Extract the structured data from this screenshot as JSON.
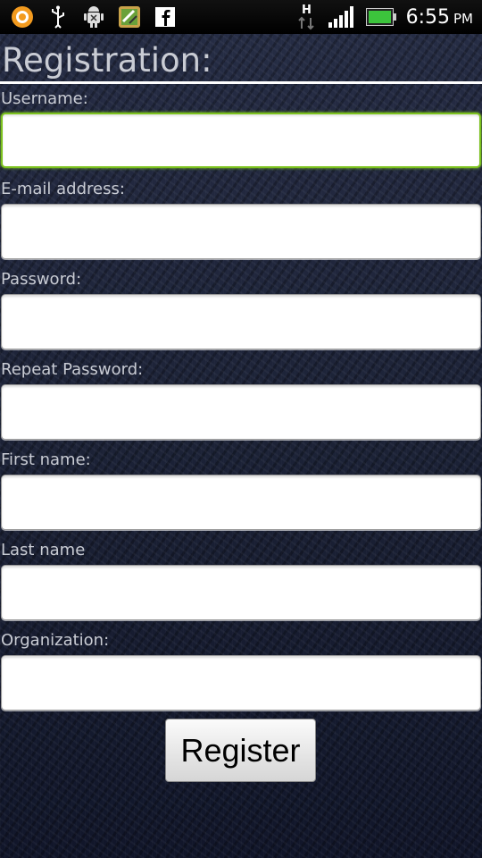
{
  "status_bar": {
    "network_type": "H",
    "time": "6:55",
    "ampm": "PM",
    "notification_icons": [
      "app-circle-icon",
      "usb-icon",
      "android-debug-icon",
      "download-app-icon",
      "facebook-icon"
    ],
    "battery_color": "#3cc43c"
  },
  "page": {
    "title": "Registration:"
  },
  "form": {
    "fields": [
      {
        "label": "Username:",
        "value": "",
        "focused": true
      },
      {
        "label": "E-mail address:",
        "value": ""
      },
      {
        "label": "Password:",
        "value": ""
      },
      {
        "label": "Repeat Password:",
        "value": ""
      },
      {
        "label": "First name:",
        "value": ""
      },
      {
        "label": "Last name",
        "value": ""
      },
      {
        "label": "Organization:",
        "value": ""
      }
    ],
    "submit_label": "Register"
  }
}
